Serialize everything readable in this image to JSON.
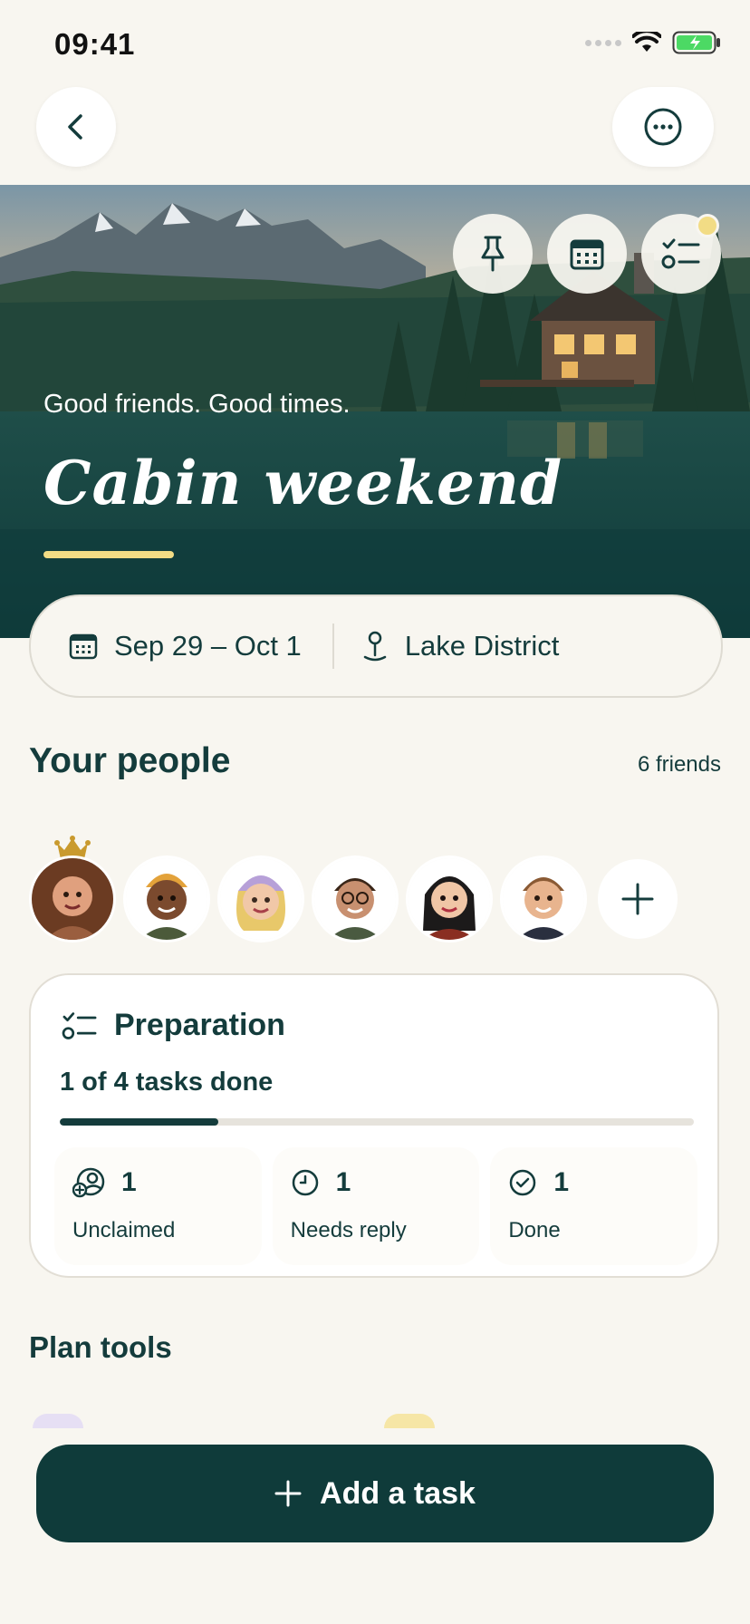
{
  "status_bar": {
    "time": "09:41"
  },
  "nav": {
    "back_icon": "chevron-left-icon",
    "more_icon": "more-horizontal-icon"
  },
  "hero": {
    "tools": [
      {
        "name": "pin",
        "icon": "pin-icon"
      },
      {
        "name": "calendar",
        "icon": "calendar-icon"
      },
      {
        "name": "checklist",
        "icon": "checklist-icon",
        "has_notification_dot": true
      }
    ],
    "tagline": "Good friends. Good times.",
    "title": "Cabin weekend",
    "accent_color": "#f2dc85"
  },
  "info": {
    "date_range": "Sep 29 – Oct 1",
    "location": "Lake District"
  },
  "people": {
    "heading": "Your people",
    "count_label": "6 friends",
    "members": [
      {
        "name": "friend-1",
        "is_host": true
      },
      {
        "name": "friend-2"
      },
      {
        "name": "friend-3"
      },
      {
        "name": "friend-4"
      },
      {
        "name": "friend-5"
      },
      {
        "name": "friend-6"
      }
    ]
  },
  "preparation": {
    "title": "Preparation",
    "progress_text": "1 of 4 tasks done",
    "done": 1,
    "total": 4,
    "progress_fraction": 0.25,
    "stats": [
      {
        "value": "1",
        "label": "Unclaimed",
        "icon": "unclaimed-user-icon"
      },
      {
        "value": "1",
        "label": "Needs reply",
        "icon": "clock-icon"
      },
      {
        "value": "1",
        "label": "Done",
        "icon": "check-circle-icon"
      }
    ]
  },
  "plan_tools": {
    "heading": "Plan tools"
  },
  "cta": {
    "label": "Add a task"
  },
  "colors": {
    "primary": "#0f3b3a",
    "text": "#143c3c",
    "background": "#f8f6f0",
    "highlight": "#f2dc85"
  }
}
